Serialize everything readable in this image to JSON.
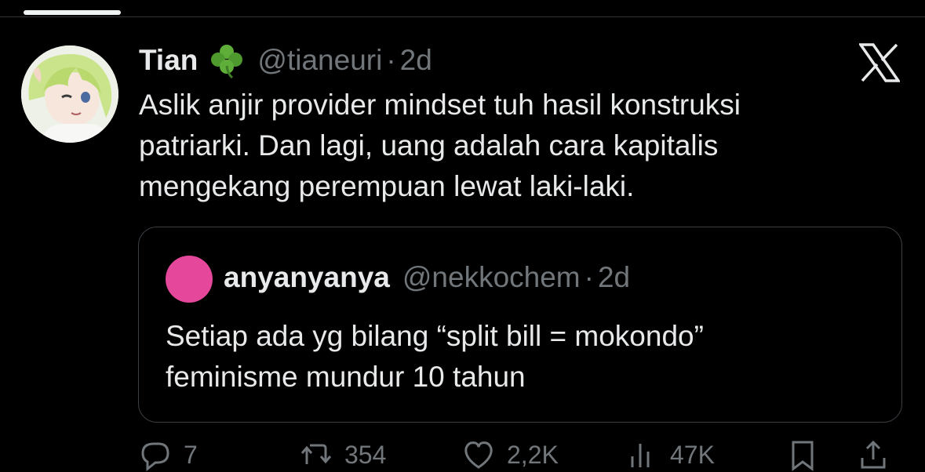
{
  "tweet": {
    "display_name": "Tian",
    "handle": "@tianeuri",
    "separator": "·",
    "time": "2d",
    "text_lines": [
      "Aslik anjir provider mindset tuh hasil konstruksi",
      "patriarki. Dan lagi, uang adalah cara kapitalis",
      "mengekang perempuan lewat laki-laki."
    ],
    "name_emoji": "clover-icon"
  },
  "quote": {
    "display_name": "anyanyanya",
    "handle": "@nekkochem",
    "separator": "·",
    "time": "2d",
    "avatar_color": "#e5479b",
    "text_lines": [
      "Setiap ada yg bilang “split bill = mokondo”",
      "feminisme mundur 10 tahun"
    ]
  },
  "actions": [
    {
      "name": "reply",
      "icon": "reply-icon",
      "count": "7"
    },
    {
      "name": "repost",
      "icon": "repost-icon",
      "count": "354"
    },
    {
      "name": "like",
      "icon": "heart-icon",
      "count": "2,2K"
    },
    {
      "name": "views",
      "icon": "views-icon",
      "count": "47K"
    },
    {
      "name": "bookmark",
      "icon": "bookmark-icon",
      "count": ""
    },
    {
      "name": "share",
      "icon": "share-icon",
      "count": ""
    }
  ],
  "colors": {
    "background": "#000000",
    "text": "#e7e9ea",
    "muted": "#71767b",
    "border": "#3a3f44"
  }
}
